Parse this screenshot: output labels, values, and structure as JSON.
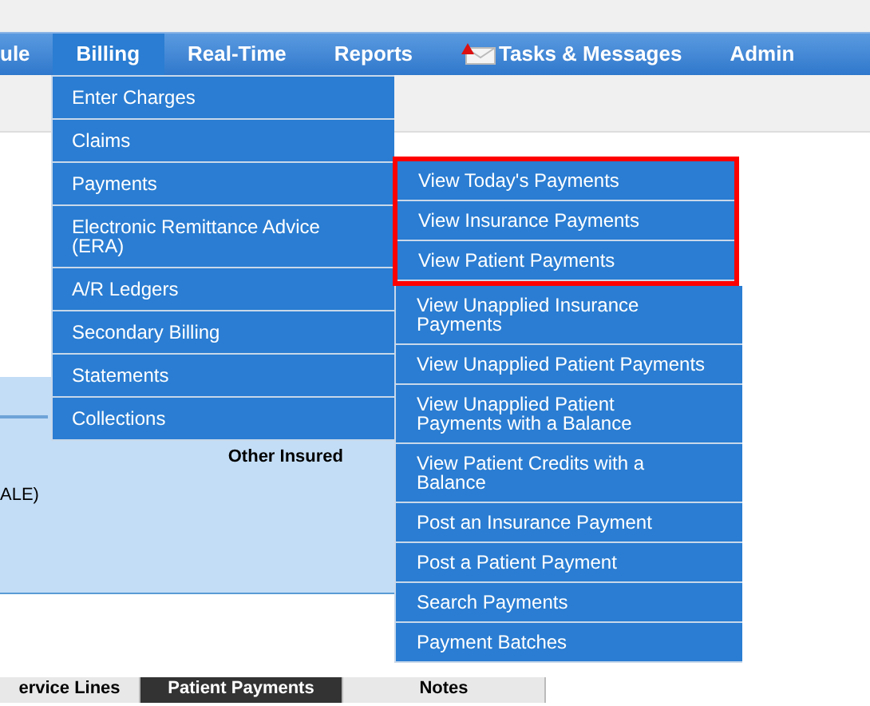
{
  "nav": [
    {
      "label": "ule",
      "selected": false,
      "icon": false
    },
    {
      "label": "Billing",
      "selected": true,
      "icon": false
    },
    {
      "label": "Real-Time",
      "selected": false,
      "icon": false
    },
    {
      "label": "Reports",
      "selected": false,
      "icon": false
    },
    {
      "label": "Tasks & Messages",
      "selected": false,
      "icon": true
    },
    {
      "label": "Admin",
      "selected": false,
      "icon": false
    }
  ],
  "billing_menu": [
    "Enter Charges",
    "Claims",
    "Payments",
    "Electronic Remittance Advice (ERA)",
    "A/R Ledgers",
    "Secondary Billing",
    "Statements",
    "Collections"
  ],
  "payments_submenu": [
    {
      "highlighted": true,
      "items": [
        "View Today's Payments",
        "View Insurance Payments",
        "View Patient Payments"
      ]
    },
    {
      "highlighted": false,
      "items": [
        "View Unapplied Insurance Payments",
        "View Unapplied Patient Payments",
        "View Unapplied Patient Payments with a Balance",
        "View Patient Credits with a Balance",
        "Post an Insurance Payment",
        "Post a Patient Payment",
        "Search Payments",
        "Payment Batches"
      ]
    }
  ],
  "panel": {
    "other_insured_label": "Other Insured",
    "text_fragment": "ALE)"
  },
  "bottom_tabs": [
    {
      "label": "ervice Lines",
      "selected": false
    },
    {
      "label": "Patient Payments",
      "selected": true
    },
    {
      "label": "Notes",
      "selected": false
    }
  ]
}
